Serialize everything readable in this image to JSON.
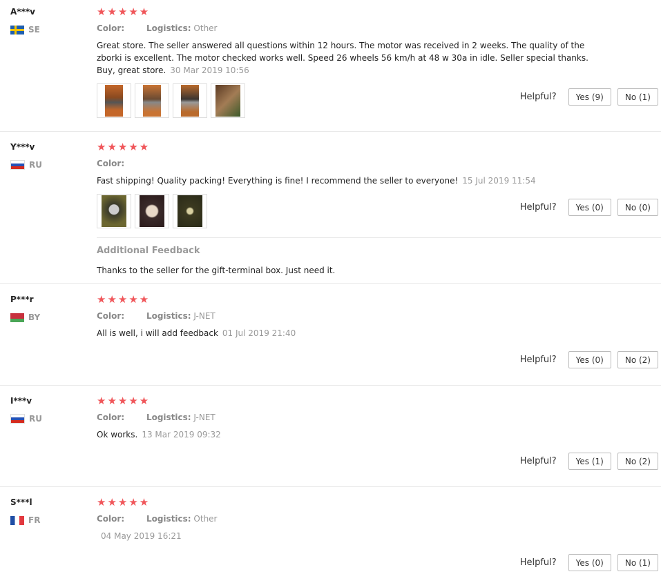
{
  "helpful_label": "Helpful?",
  "color_label": "Color:",
  "logistics_label": "Logistics:",
  "reviews": [
    {
      "user": "A***v",
      "country": "SE",
      "stars": "★★★★★",
      "logistics": "Other",
      "text": "Great store. The seller answered all questions within 12 hours. The motor was received in 2 weeks. The quality of the zborki is excellent. The motor checked works well. Speed 26 wheels 56 km/h at 48 w 30a in idle. Seller special thanks. Buy, great store.",
      "date": "30 Mar 2019 10:56",
      "yes": "Yes (9)",
      "no": "No (1)"
    },
    {
      "user": "Y***v",
      "country": "RU",
      "stars": "★★★★★",
      "logistics": "",
      "text": "Fast shipping! Quality packing! Everything is fine! I recommend the seller to everyone!",
      "date": "15 Jul 2019 11:54",
      "yes": "Yes (0)",
      "no": "No (0)",
      "additional_title": "Additional Feedback",
      "additional_text": "Thanks to the seller for the gift-terminal box. Just need it."
    },
    {
      "user": "P***r",
      "country": "BY",
      "stars": "★★★★★",
      "logistics": "J-NET",
      "text": "All is well, i will add feedback",
      "date": "01 Jul 2019 21:40",
      "yes": "Yes (0)",
      "no": "No (2)"
    },
    {
      "user": "I***v",
      "country": "RU",
      "stars": "★★★★★",
      "logistics": "J-NET",
      "text": "Ok works.",
      "date": "13 Mar 2019 09:32",
      "yes": "Yes (1)",
      "no": "No (2)"
    },
    {
      "user": "S***l",
      "country": "FR",
      "stars": "★★★★★",
      "logistics": "Other",
      "text": "",
      "date": "04 May 2019 16:21",
      "yes": "Yes (0)",
      "no": "No (1)"
    }
  ],
  "colors": {
    "star": "#f0565a",
    "muted": "#999999"
  }
}
